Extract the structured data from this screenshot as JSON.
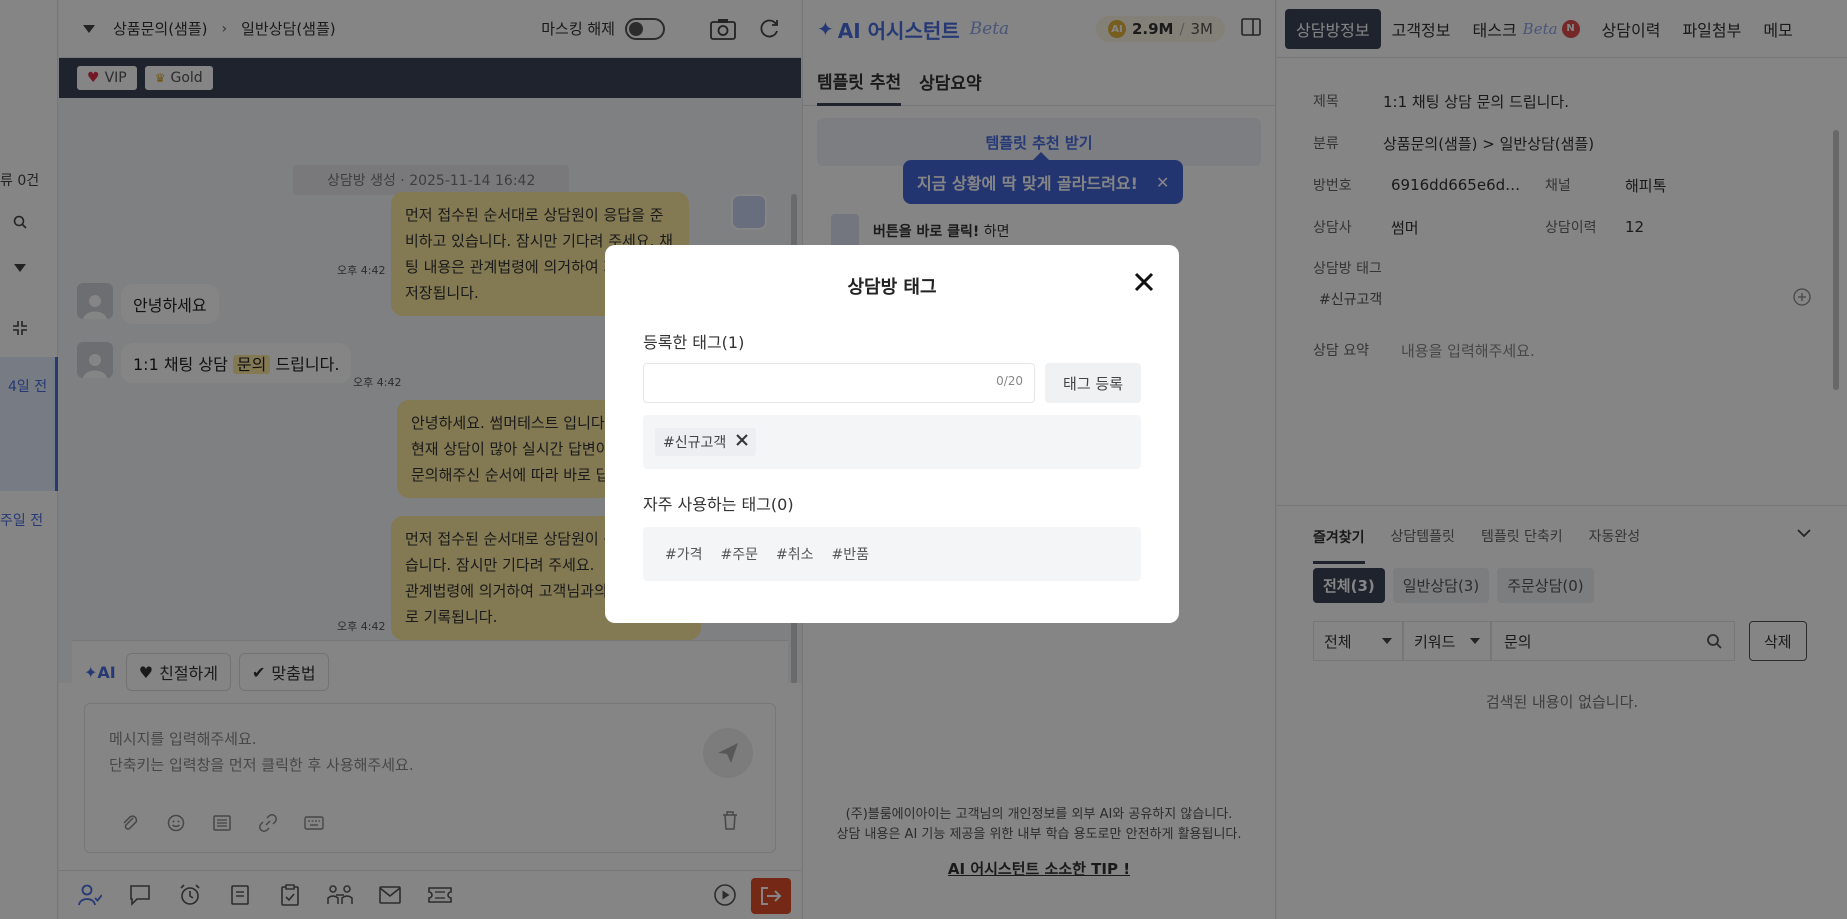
{
  "left_strip": {
    "count_text": "류 0건",
    "item_days_4": "4일 전",
    "item_week_1": "주일 전"
  },
  "chat": {
    "breadcrumb": [
      "상품문의(샘플)",
      "일반상담(샘플)"
    ],
    "masking_label": "마스킹 해제",
    "badges": [
      {
        "label": "VIP",
        "icon": "heart-icon"
      },
      {
        "label": "Gold",
        "icon": "crown-icon"
      }
    ],
    "system_message": "상담방 생성 · 2025-11-14 16:42",
    "messages": {
      "bot1": "먼저 접수된 순서대로 상담원이 응답을 준비하고 있습니다. 잠시만 기다려 주세요. 채팅 내용은 관계법령에 의거하여 자동으로 저장됩니다.",
      "bot1_time": "오후 4:42",
      "cust1": "안녕하세요",
      "cust2_pre": "1:1 채팅 상담",
      "cust2_hl": "문의",
      "cust2_post": "드립니다.",
      "cust2_time": "오후 4:42",
      "agent1_line1": "안녕하세요. 썸머테스트 입니다.",
      "agent1_line2": "현재 상담이 많아 실시간 답변이",
      "agent1_line3": "문의해주신 순서에 따라 바로 답",
      "bot2_line1": "먼저 접수된 순서대로 상담원이 응",
      "bot2_line2": "습니다. 잠시만 기다려 주세요.",
      "bot2_line3": "관계법령에 의거하여 고객님과의",
      "bot2_line4": "로 기록됩니다.",
      "bot2_time": "오후 4:42"
    },
    "composer": {
      "ai_label": "AI",
      "tone_kind": "친절하게",
      "tone_spell": "맞춤법",
      "placeholder_line1": "메시지를 입력해주세요.",
      "placeholder_line2": "단축키는 입력창을 먼저 클릭한 후 사용해주세요."
    }
  },
  "ai_panel": {
    "title": "AI 어시스턴트",
    "beta": "Beta",
    "token_used": "2.9M",
    "token_total": "3M",
    "token_coin": "AI",
    "tabs": [
      "템플릿 추천",
      "상담요약"
    ],
    "rec_button": "템플릿 추천 받기",
    "tooltip": "지금 상황에 딱 맞게 골라드려요!",
    "hint_bold": "버튼을 바로 클릭!",
    "hint_rest": "하면",
    "footer_line1": "(주)블룸에이아이는 고객님의 개인정보를 외부 AI와 공유하지 않습니다.",
    "footer_line2": "상담 내용은 AI 기능 제공을 위한 내부 학습 용도로만 안전하게 활용됩니다.",
    "tip_link": "AI 어시스턴트 소소한 TIP !"
  },
  "info_panel": {
    "tabs": [
      {
        "label": "상담방정보",
        "active": true
      },
      {
        "label": "고객정보",
        "active": false
      },
      {
        "label": "태스크",
        "active": false,
        "beta": "Beta",
        "badge": "N"
      },
      {
        "label": "상담이력",
        "active": false
      },
      {
        "label": "파일첨부",
        "active": false
      },
      {
        "label": "메모",
        "active": false
      }
    ],
    "fields": {
      "title_k": "제목",
      "title_v": "1:1 채팅 상담 문의 드립니다.",
      "cat_k": "분류",
      "cat_v": "상품문의(샘플) > 일반상담(샘플)",
      "room_k": "방번호",
      "room_v": "6916dd665e6d…",
      "channel_k": "채널",
      "channel_v": "해피톡",
      "agent_k": "상담사",
      "agent_v": "썸머",
      "history_k": "상담이력",
      "history_v": "12",
      "tag_k": "상담방 태그",
      "tag_v": "#신규고객",
      "summary_k": "상담 요약",
      "summary_v": "내용을 입력해주세요."
    },
    "fav_tabs": [
      "즐겨찾기",
      "상담템플릿",
      "템플릿 단축키",
      "자동완성"
    ],
    "segments": [
      "전체(3)",
      "일반상담(3)",
      "주문상담(0)"
    ],
    "filter_all": "전체",
    "filter_keyword": "키워드",
    "search_value": "문의",
    "delete_label": "삭제",
    "empty_text": "검색된 내용이 없습니다."
  },
  "modal": {
    "title": "상담방 태그",
    "registered_label": "등록한 태그(1)",
    "input_value": "",
    "counter": "0/20",
    "register_button": "태그 등록",
    "registered_tags": [
      "#신규고객"
    ],
    "frequent_label": "자주 사용하는 태그(0)",
    "frequent_tags": [
      "#가격",
      "#주문",
      "#취소",
      "#반품"
    ]
  },
  "colors": {
    "accent": "#4a6ee0",
    "dark": "#3a4458",
    "bubble": "#fce8a0",
    "exit": "#e04e2a"
  }
}
